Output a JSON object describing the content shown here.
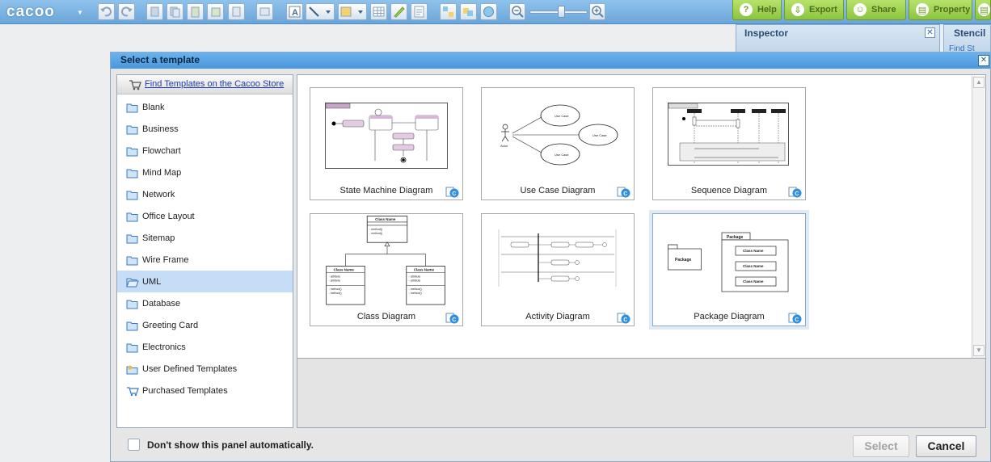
{
  "app": {
    "logo": "cacoo"
  },
  "toolbar": {
    "buttons": [
      {
        "name": "help",
        "label": "Help",
        "icon": "question-icon"
      },
      {
        "name": "export",
        "label": "Export",
        "icon": "export-icon"
      },
      {
        "name": "share",
        "label": "Share",
        "icon": "share-icon"
      },
      {
        "name": "property",
        "label": "Property",
        "icon": "property-icon"
      }
    ]
  },
  "panels": {
    "inspector_title": "Inspector",
    "stencil_title": "Stencil",
    "stencil_find": "Find St"
  },
  "dialog": {
    "title": "Select a template",
    "store_link": "Find Templates on the Cacoo Store",
    "categories": [
      {
        "label": "Blank",
        "icon": "folder-icon"
      },
      {
        "label": "Business",
        "icon": "folder-icon"
      },
      {
        "label": "Flowchart",
        "icon": "folder-icon"
      },
      {
        "label": "Mind Map",
        "icon": "folder-icon"
      },
      {
        "label": "Network",
        "icon": "folder-icon"
      },
      {
        "label": "Office Layout",
        "icon": "folder-icon"
      },
      {
        "label": "Sitemap",
        "icon": "folder-icon"
      },
      {
        "label": "Wire Frame",
        "icon": "folder-icon"
      },
      {
        "label": "UML",
        "icon": "folder-open-icon",
        "selected": true
      },
      {
        "label": "Database",
        "icon": "folder-icon"
      },
      {
        "label": "Greeting Card",
        "icon": "folder-icon"
      },
      {
        "label": "Electronics",
        "icon": "folder-icon"
      },
      {
        "label": "User Defined Templates",
        "icon": "user-folder-icon"
      },
      {
        "label": "Purchased Templates",
        "icon": "cart-icon"
      }
    ],
    "templates": [
      {
        "label": "State Machine Diagram"
      },
      {
        "label": "Use Case Diagram"
      },
      {
        "label": "Sequence Diagram"
      },
      {
        "label": "Class Diagram"
      },
      {
        "label": "Activity Diagram"
      },
      {
        "label": "Package Diagram",
        "selected": true
      }
    ],
    "thumb_text": {
      "use_case": "Use Case",
      "actor": "Actor",
      "class_name": "Class Name",
      "package": "Package",
      "method": "- method()",
      "attribute": "- attribute"
    },
    "dont_show": "Don't show this panel automatically.",
    "select_label": "Select",
    "cancel_label": "Cancel"
  },
  "colors": {
    "accent": "#4a97dd",
    "green": "#8cc43f",
    "selection": "#c5ddf6"
  }
}
